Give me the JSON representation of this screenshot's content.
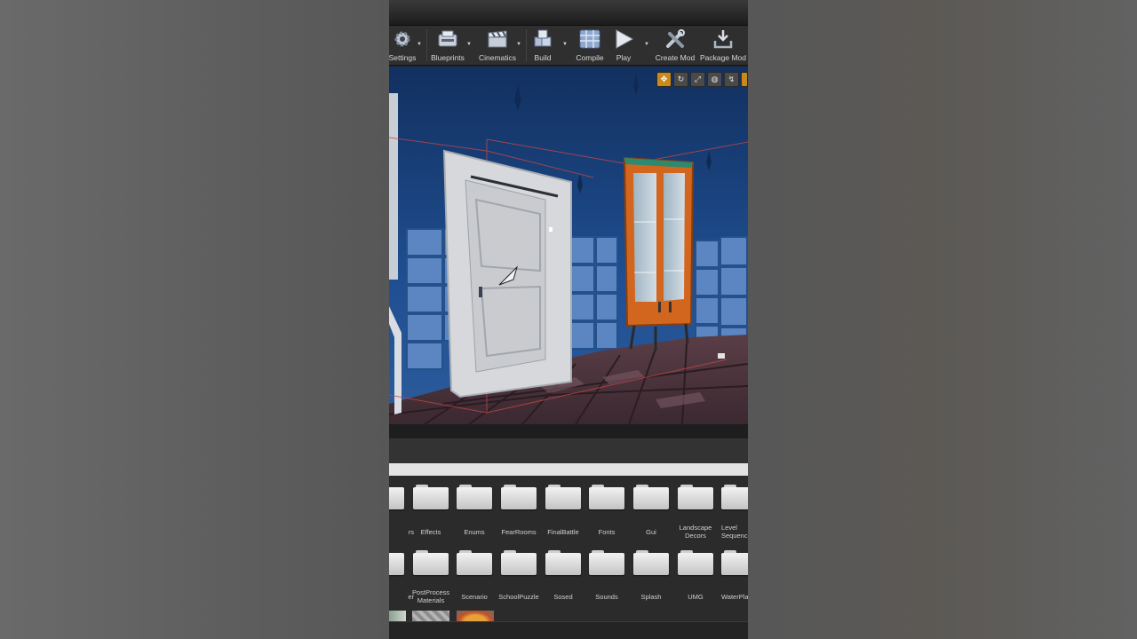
{
  "toolbar": {
    "settings": "Settings",
    "blueprints": "Blueprints",
    "cinematics": "Cinematics",
    "build": "Build",
    "compile": "Compile",
    "play": "Play",
    "create_mod": "Create Mod",
    "package_mod": "Package Mod"
  },
  "content_browser": {
    "row1": [
      "rs",
      "Effects",
      "Enums",
      "FearRooms",
      "FinalBattle",
      "Fonts",
      "Gui",
      "Landscape Decors",
      "Level Sequenc"
    ],
    "row2": [
      "er",
      "PostProcess Materials",
      "Scenario",
      "SchoolPuzzle",
      "Sosed",
      "Sounds",
      "Splash",
      "UMG",
      "WaterPla"
    ]
  },
  "colors": {
    "accent": "#c98a1a",
    "viewport_wall": "#1f4f8f",
    "door": "#d8d8d8",
    "cabinet": "#d2661e"
  }
}
